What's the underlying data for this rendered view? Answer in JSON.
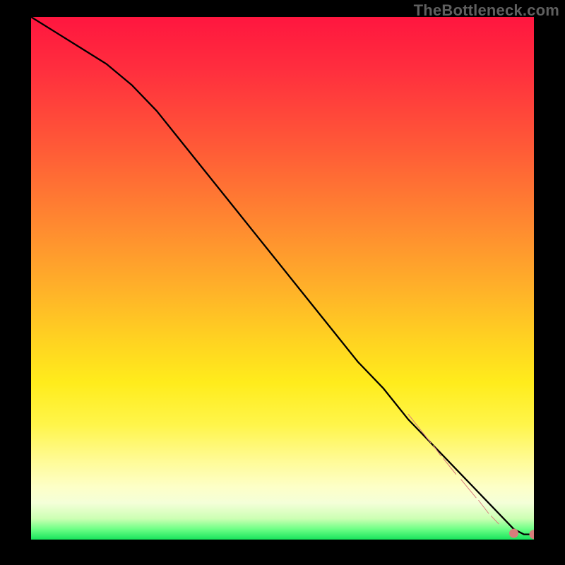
{
  "watermark": "TheBottleneck.com",
  "gradient_colors": {
    "top": "#ff163f",
    "mid_orange": "#ff8a30",
    "mid_yellow": "#ffec1c",
    "pale": "#fdffc8",
    "green": "#18e45c"
  },
  "chart_data": {
    "type": "line",
    "title": "",
    "xlabel": "",
    "ylabel": "",
    "xlim": [
      0,
      100
    ],
    "ylim": [
      0,
      100
    ],
    "grid": false,
    "legend": false,
    "series": [
      {
        "name": "bottleneck-curve",
        "color": "#000000",
        "x": [
          0,
          5,
          10,
          15,
          20,
          25,
          30,
          35,
          40,
          45,
          50,
          55,
          60,
          65,
          70,
          75,
          78,
          80,
          82,
          84,
          86,
          88,
          90,
          92,
          94,
          96,
          98,
          100
        ],
        "y": [
          100,
          97,
          94,
          91,
          87,
          82,
          76,
          70,
          64,
          58,
          52,
          46,
          40,
          34,
          29,
          23,
          20,
          18,
          16,
          14,
          12,
          10,
          8,
          6,
          4,
          2,
          1,
          1
        ]
      }
    ],
    "markers": {
      "name": "segment-markers",
      "color": "#d77d7c",
      "segments": [
        {
          "x0": 75.0,
          "y0": 24.0,
          "x1": 79.5,
          "y1": 18.5
        },
        {
          "x0": 80.0,
          "y0": 18.0,
          "x1": 81.5,
          "y1": 16.0
        },
        {
          "x0": 82.0,
          "y0": 15.5,
          "x1": 84.5,
          "y1": 12.5
        },
        {
          "x0": 85.5,
          "y0": 11.5,
          "x1": 88.5,
          "y1": 8.0
        },
        {
          "x0": 89.0,
          "y0": 7.5,
          "x1": 91.0,
          "y1": 5.0
        },
        {
          "x0": 91.5,
          "y0": 4.5,
          "x1": 93.0,
          "y1": 3.0
        }
      ],
      "points": [
        {
          "x": 96.0,
          "y": 1.2
        },
        {
          "x": 100.0,
          "y": 1.0
        }
      ]
    }
  }
}
